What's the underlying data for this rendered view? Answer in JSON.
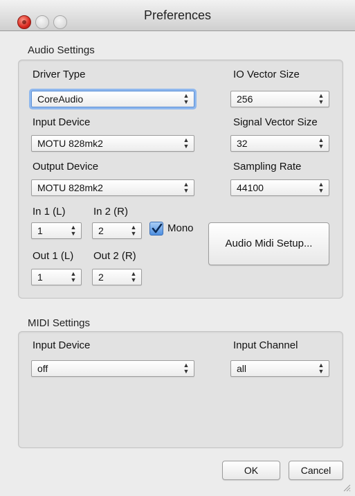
{
  "window": {
    "title": "Preferences"
  },
  "audio": {
    "section_title": "Audio Settings",
    "driver_type": {
      "label": "Driver Type",
      "value": "CoreAudio"
    },
    "io_vector_size": {
      "label": "IO Vector Size",
      "value": "256"
    },
    "input_device": {
      "label": "Input Device",
      "value": "MOTU 828mk2"
    },
    "signal_vector_size": {
      "label": "Signal Vector Size",
      "value": "32"
    },
    "output_device": {
      "label": "Output Device",
      "value": "MOTU 828mk2"
    },
    "sampling_rate": {
      "label": "Sampling Rate",
      "value": "44100"
    },
    "in1": {
      "label": "In 1 (L)",
      "value": "1"
    },
    "in2": {
      "label": "In 2 (R)",
      "value": "2"
    },
    "mono": {
      "label": "Mono",
      "checked": true
    },
    "out1": {
      "label": "Out 1 (L)",
      "value": "1"
    },
    "out2": {
      "label": "Out 2 (R)",
      "value": "2"
    },
    "audio_midi_setup_button": "Audio Midi Setup..."
  },
  "midi": {
    "section_title": "MIDI Settings",
    "input_device": {
      "label": "Input Device",
      "value": "off"
    },
    "input_channel": {
      "label": "Input Channel",
      "value": "all"
    }
  },
  "buttons": {
    "ok": "OK",
    "cancel": "Cancel"
  },
  "colors": {
    "focus_ring": "#8fb8ee",
    "checkbox_fill": "#4f8fe0",
    "close_button": "#d8291f",
    "window_bg": "#ececec"
  }
}
